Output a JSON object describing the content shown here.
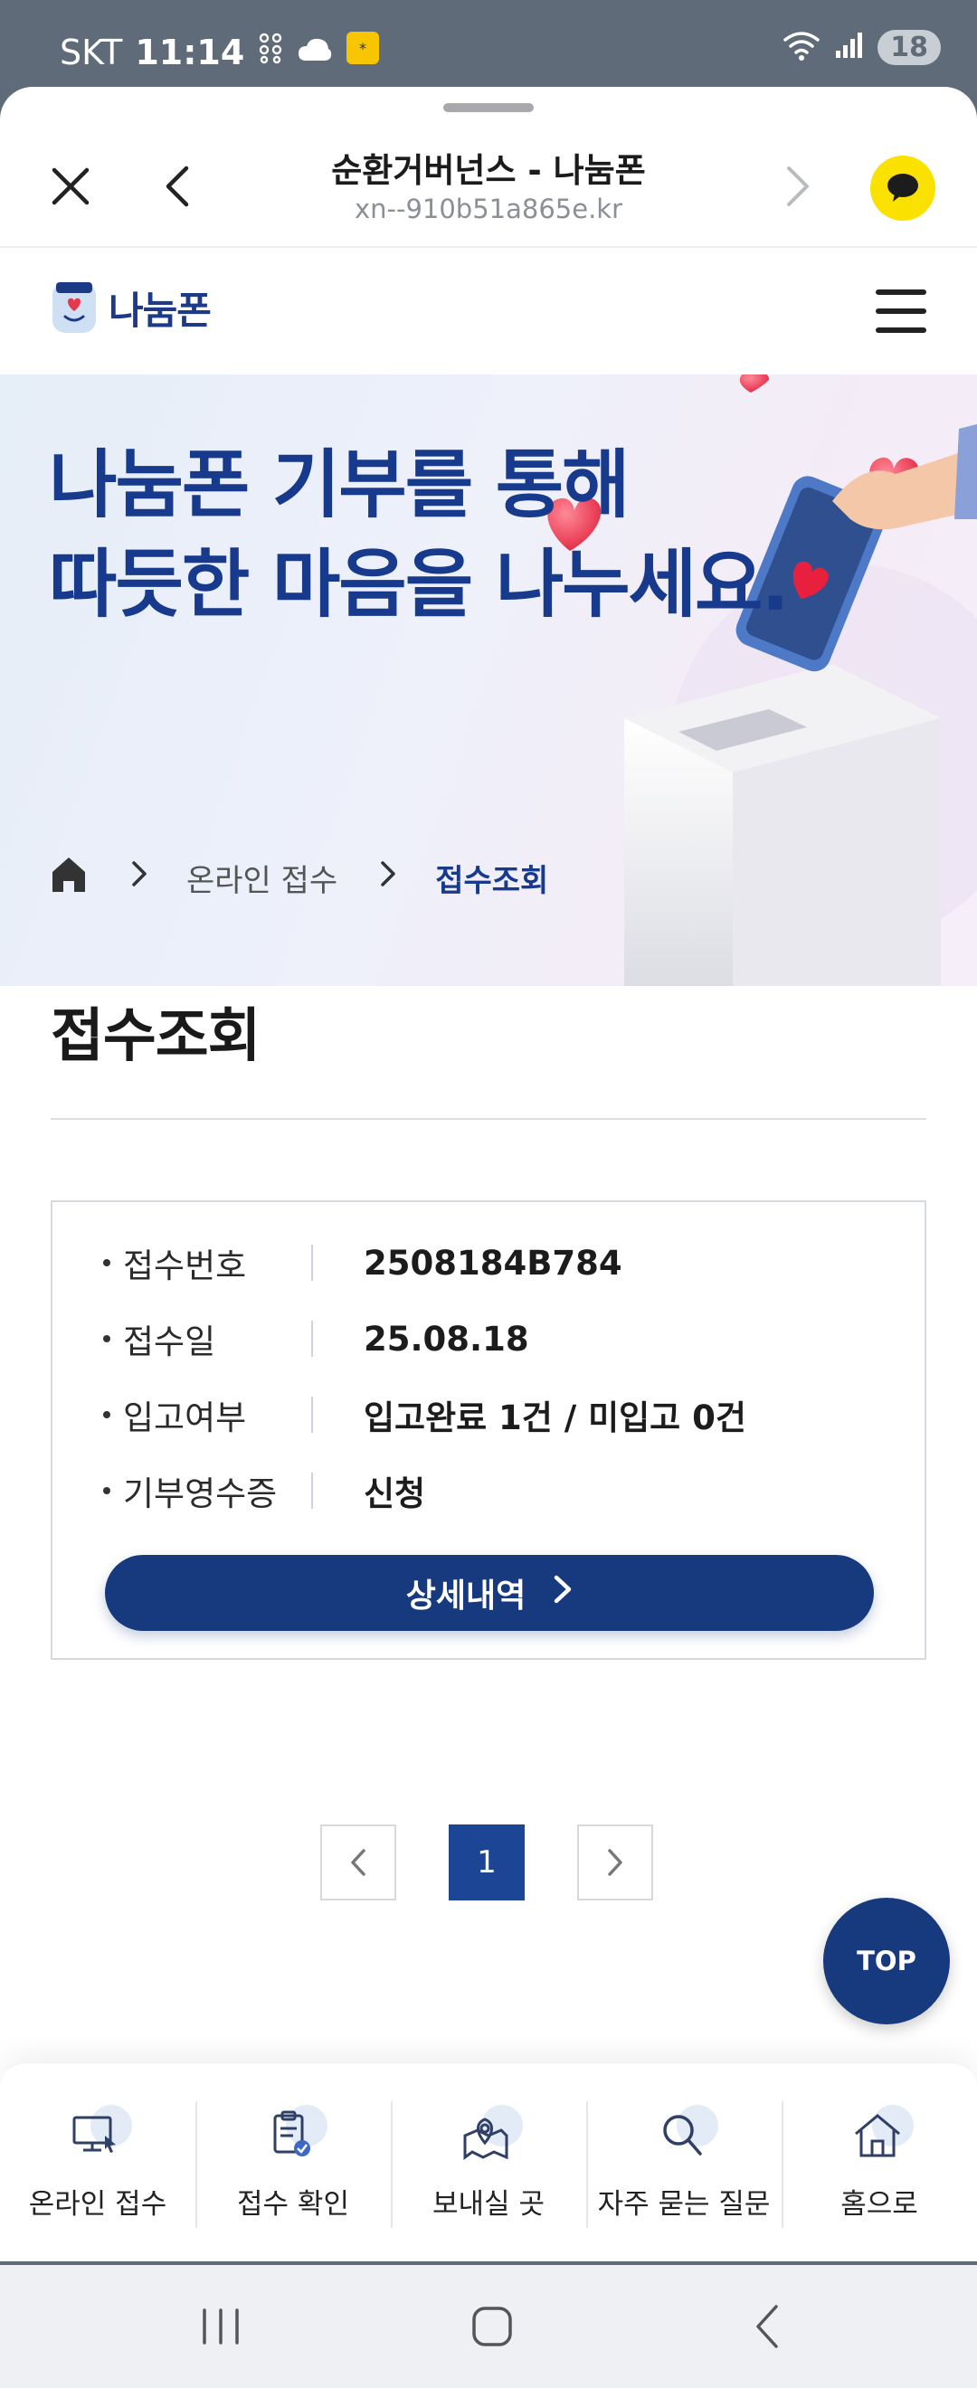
{
  "status_bar": {
    "carrier": "SKT",
    "time": "11:14",
    "battery": "18"
  },
  "browser": {
    "title": "순환거버넌스 - 나눔폰",
    "url": "xn--910b51a865e.kr",
    "icons": [
      "close-icon",
      "back-icon",
      "forward-icon",
      "kakao-talk-icon"
    ]
  },
  "site": {
    "logo_text": "나눔폰"
  },
  "hero": {
    "line1": "나눔폰 기부를 통해",
    "line2": "따듯한 마음을 나누세요.",
    "breadcrumb": {
      "level1": "온라인 접수",
      "current": "접수조회"
    }
  },
  "page": {
    "title": "접수조회"
  },
  "receipt": {
    "rows": [
      {
        "label": "접수번호",
        "value": "2508184B784"
      },
      {
        "label": "접수일",
        "value": "25.08.18"
      },
      {
        "label": "입고여부",
        "value": "입고완료 1건 / 미입고 0건"
      },
      {
        "label": "기부영수증",
        "value": "신청"
      }
    ],
    "detail_button": "상세내역"
  },
  "pagination": {
    "current": "1"
  },
  "top_button": "TOP",
  "bottom_nav": [
    {
      "label": "온라인 접수",
      "icon": "online-monitor-icon"
    },
    {
      "label": "접수 확인",
      "icon": "clipboard-check-icon"
    },
    {
      "label": "보내실 곳",
      "icon": "map-pin-icon"
    },
    {
      "label": "자주 묻는 질문",
      "icon": "search-icon"
    },
    {
      "label": "홈으로",
      "icon": "home-icon"
    }
  ],
  "colors": {
    "primary": "#173a7e",
    "hero_text": "#173a8c",
    "kakao": "#fae100"
  }
}
